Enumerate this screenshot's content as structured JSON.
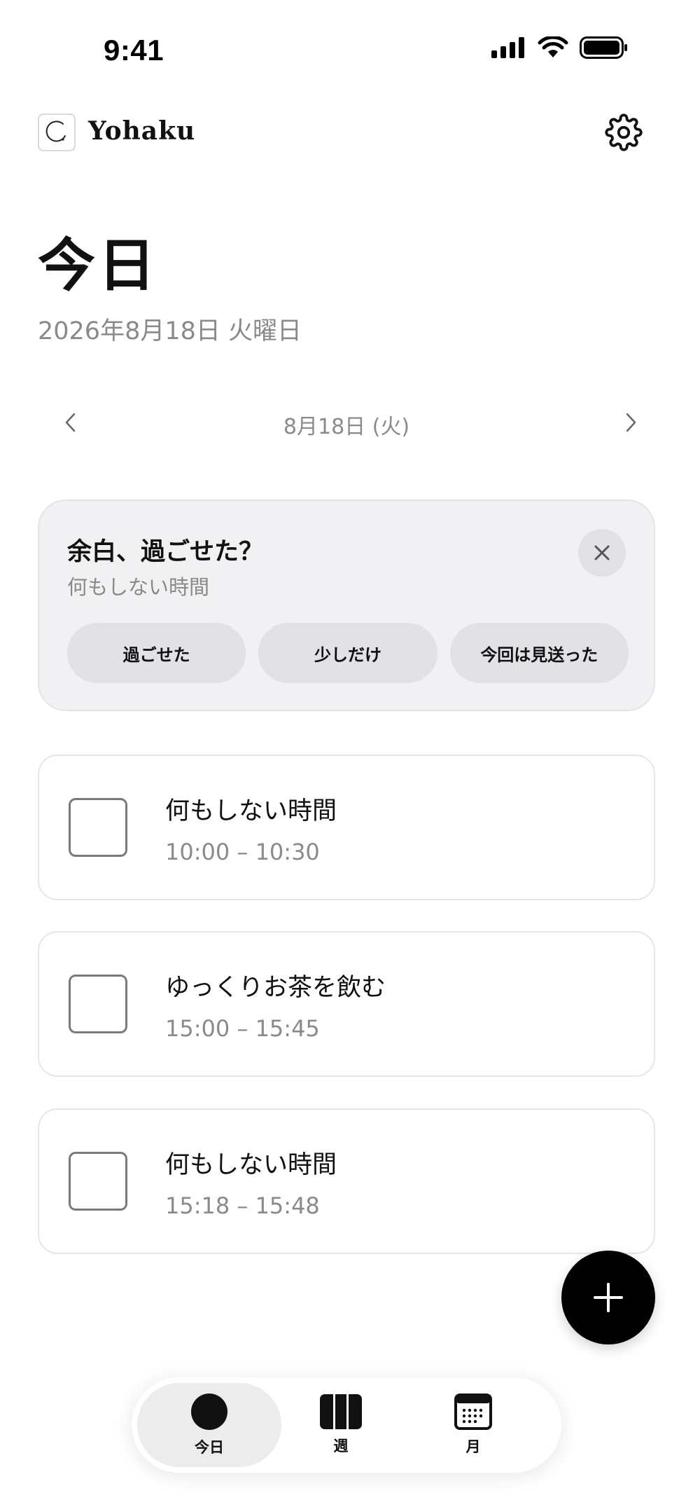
{
  "status_bar": {
    "time": "9:41"
  },
  "header": {
    "app_name": "Yohaku"
  },
  "page": {
    "title": "今日",
    "date": "2026年8月18日 火曜日"
  },
  "date_nav": {
    "label": "8月18日 (火)"
  },
  "reflection": {
    "question": "余白、過ごせた？",
    "subtitle": "何もしない時間",
    "options": [
      "過ごせた",
      "少しだけ",
      "今回は見送った"
    ]
  },
  "tasks": [
    {
      "title": "何もしない時間",
      "time": "10:00 – 10:30"
    },
    {
      "title": "ゆっくりお茶を飲む",
      "time": "15:00 – 15:45"
    },
    {
      "title": "何もしない時間",
      "time": "15:18 – 15:48"
    }
  ],
  "tabs": [
    {
      "label": "今日",
      "icon": "circle-icon",
      "active": true
    },
    {
      "label": "週",
      "icon": "columns-icon",
      "active": false
    },
    {
      "label": "月",
      "icon": "calendar-icon",
      "active": false
    }
  ],
  "colors": {
    "accent": "#000000",
    "muted_text": "#8a8a8a",
    "card_bg": "#f1f1f4"
  }
}
